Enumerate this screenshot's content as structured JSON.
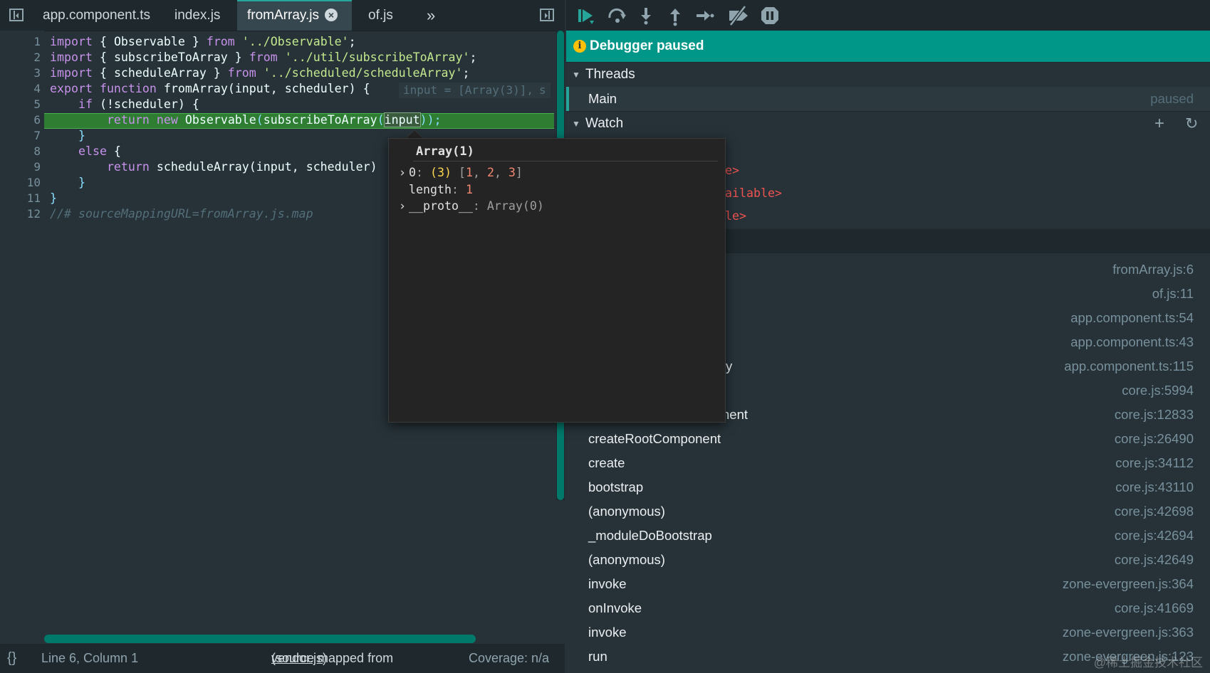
{
  "tabs": [
    {
      "label": "app.component.ts"
    },
    {
      "label": "index.js"
    },
    {
      "label": "fromArray.js",
      "active": true
    },
    {
      "label": "of.js"
    }
  ],
  "tabs_overflow_label": "»",
  "editor": {
    "line_numbers": [
      "1",
      "2",
      "3",
      "4",
      "5",
      "6",
      "7",
      "8",
      "9",
      "10",
      "11",
      "12"
    ],
    "inline_value": "input = [Array(3)],",
    "inline_value_cut": "s",
    "highlighted_line": 6,
    "code": {
      "l1": {
        "kw1": "import",
        "p1": " { ",
        "id": "Observable",
        "p2": " } ",
        "kw2": "from",
        "sp": " ",
        "str": "'../Observable'",
        "end": ";"
      },
      "l2": {
        "kw1": "import",
        "p1": " { ",
        "id": "subscribeToArray",
        "p2": " } ",
        "kw2": "from",
        "sp": " ",
        "str": "'../util/subscribeToArray'",
        "end": ";"
      },
      "l3": {
        "kw1": "import",
        "p1": " { ",
        "id": "scheduleArray",
        "p2": " } ",
        "kw2": "from",
        "sp": " ",
        "str": "'../scheduled/scheduleArray'",
        "end": ";"
      },
      "l4": {
        "kw1": "export",
        "sp1": " ",
        "kw2": "function",
        "sp2": " ",
        "fn": "fromArray",
        "p1": "(",
        "a1": "input",
        "c": ", ",
        "a2": "scheduler",
        "p2": ") {"
      },
      "l5": {
        "indent": "    ",
        "kw": "if",
        "p1": " (!",
        "id": "scheduler",
        "p2": ") {"
      },
      "l6": {
        "indent": "        ",
        "kw1": "return",
        "sp": " ",
        "kw2": "new",
        "sp2": " ",
        "cls": "Observable",
        "p1": "(",
        "fn": "subscribeToArray",
        "p2": "(",
        "arg": "input",
        "p3": "));"
      },
      "l7": {
        "text": "    }"
      },
      "l8": {
        "indent": "    ",
        "kw": "else",
        "p": " {"
      },
      "l9": {
        "indent": "        ",
        "kw": "return",
        "sp": " ",
        "fn": "scheduleArray",
        "p1": "(",
        "a1": "input",
        "c": ", ",
        "a2": "scheduler",
        "p2": ")"
      },
      "l10": {
        "text": "    }"
      },
      "l11": {
        "text": "}"
      },
      "l12": {
        "text": "//# sourceMappingURL=fromArray.js.map"
      }
    }
  },
  "status": {
    "braces": "{}",
    "position": "Line 6, Column 1",
    "mapped_prefix": "(source mapped from ",
    "mapped_link": "vendor.js",
    "mapped_suffix": ")",
    "coverage": "Coverage: n/a"
  },
  "popup": {
    "title": "Array(1)",
    "rows": [
      {
        "caret": "›",
        "key": "0",
        "colon": ": ",
        "count": "(3)",
        "vals_open": " [",
        "v1": "1",
        "c1": ", ",
        "v2": "2",
        "c2": ", ",
        "v3": "3",
        "vals_close": "]"
      },
      {
        "caret": "",
        "key": "length",
        "colon": ": ",
        "value": "1"
      },
      {
        "caret": "›",
        "key": "__proto__",
        "colon": ": ",
        "value": "Array(0)"
      }
    ]
  },
  "debugger": {
    "banner": "Debugger paused",
    "threads_label": "Threads",
    "thread": {
      "name": "Main",
      "state": "paused"
    },
    "watch_label": "Watch",
    "watch_partials": [
      "e>",
      "ailable>",
      "le>"
    ],
    "hidden_frame_fragments": [
      "y",
      "nent"
    ],
    "call_stack": [
      {
        "name": "",
        "loc": "fromArray.js:6"
      },
      {
        "name": "",
        "loc": "of.js:11"
      },
      {
        "name": "",
        "loc": "app.component.ts:54"
      },
      {
        "name": "",
        "loc": "app.component.ts:43"
      },
      {
        "name": "",
        "loc": "app.component.ts:115"
      },
      {
        "name": "",
        "loc": "core.js:5994"
      },
      {
        "name": "",
        "loc": "core.js:12833"
      },
      {
        "name": "createRootComponent",
        "loc": "core.js:26490"
      },
      {
        "name": "create",
        "loc": "core.js:34112"
      },
      {
        "name": "bootstrap",
        "loc": "core.js:43110"
      },
      {
        "name": "(anonymous)",
        "loc": "core.js:42698"
      },
      {
        "name": "_moduleDoBootstrap",
        "loc": "core.js:42694"
      },
      {
        "name": "(anonymous)",
        "loc": "core.js:42649"
      },
      {
        "name": "invoke",
        "loc": "zone-evergreen.js:364"
      },
      {
        "name": "onInvoke",
        "loc": "core.js:41669"
      },
      {
        "name": "invoke",
        "loc": "zone-evergreen.js:363"
      },
      {
        "name": "run",
        "loc": "zone-evergreen.js:123"
      }
    ]
  },
  "watermark": "@稀土掘金技术社区",
  "colors": {
    "accent": "#009688",
    "highlight": "#2e7d32",
    "bg": "#263238"
  }
}
